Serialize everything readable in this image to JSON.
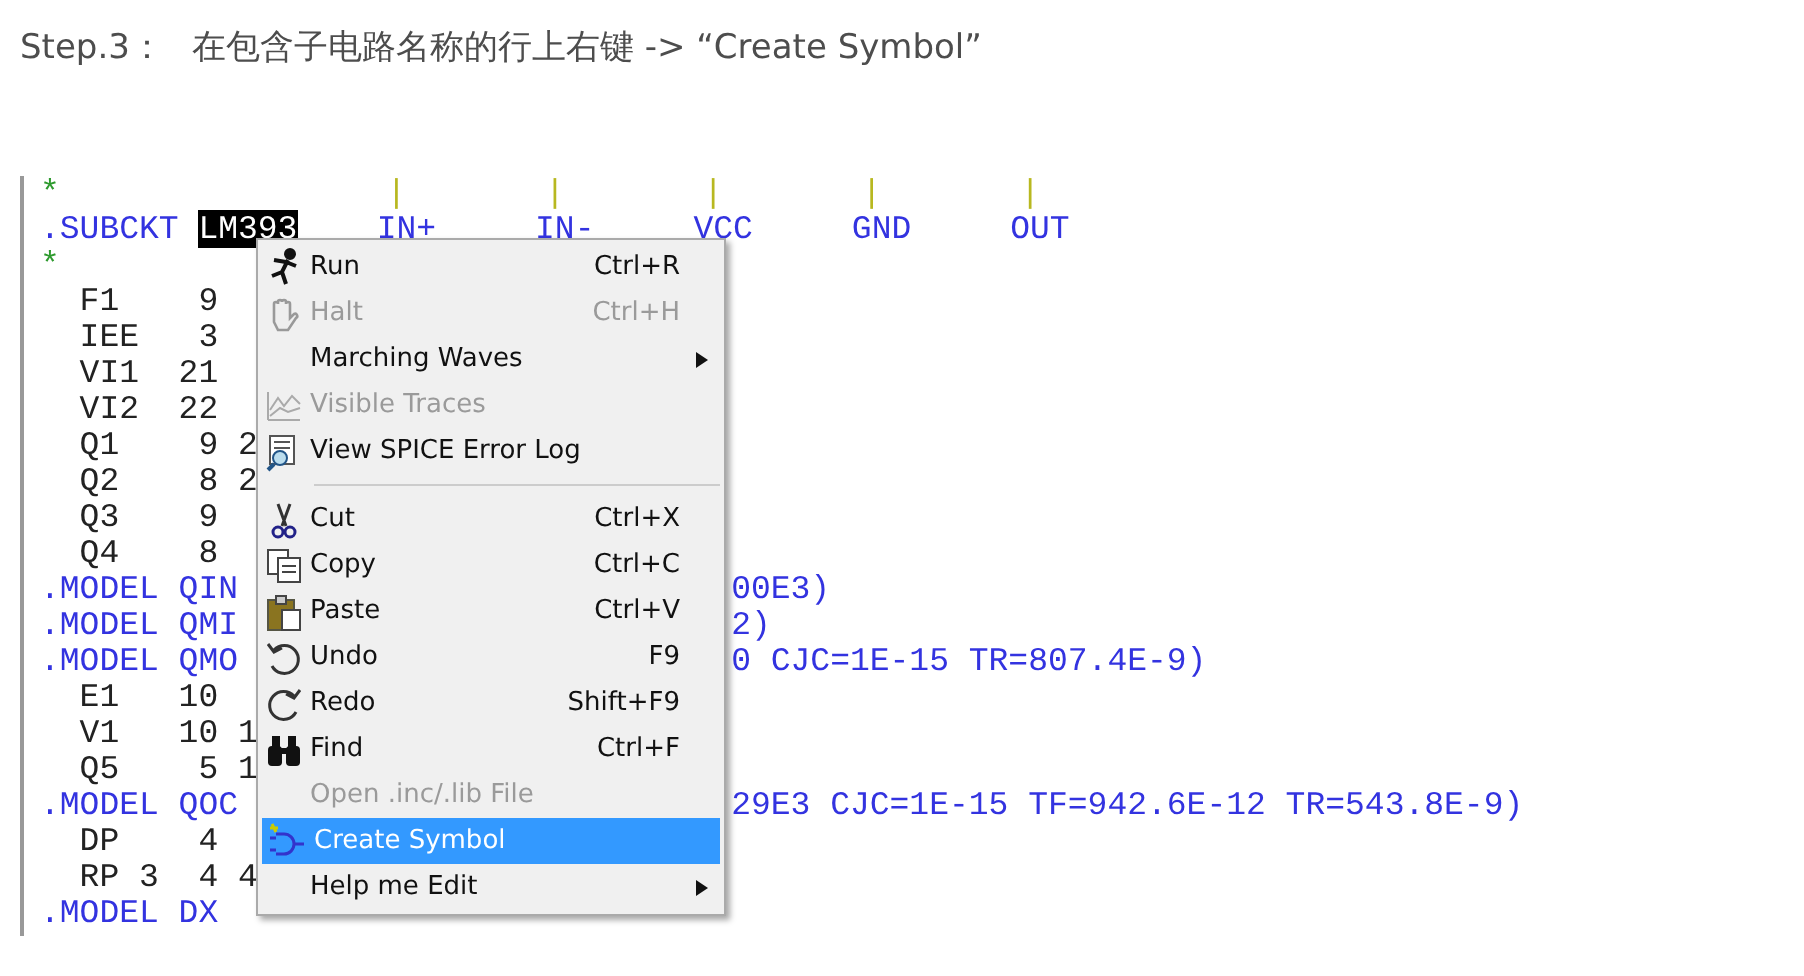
{
  "heading": {
    "step": "Step.3：",
    "text": "在包含子电路名称的行上右键 -> “Create Symbol”"
  },
  "editor": {
    "marker_line": {
      "star": "*",
      "marks": [
        "|",
        "|",
        "|",
        "|",
        "|"
      ]
    },
    "subckt_line": {
      "keyword": ".SUBCKT",
      "name": "LM393",
      "name_selected": true,
      "pins": [
        "IN+",
        "IN-",
        "VCC",
        "GND",
        "OUT"
      ]
    },
    "lines": [
      {
        "kind": "comment",
        "text": "*"
      },
      {
        "kind": "element",
        "text": "  F1    9"
      },
      {
        "kind": "element",
        "text": "  IEE   3"
      },
      {
        "kind": "element",
        "text": "  VI1  21"
      },
      {
        "kind": "element",
        "text": "  VI2  22"
      },
      {
        "kind": "element",
        "text": "  Q1    9 2"
      },
      {
        "kind": "element",
        "text": "  Q2    8 2"
      },
      {
        "kind": "element",
        "text": "  Q3    9"
      },
      {
        "kind": "element",
        "text": "  Q4    8"
      },
      {
        "kind": "directive",
        "text": ".MODEL QIN",
        "tail": "00E3)"
      },
      {
        "kind": "directive",
        "text": ".MODEL QMI",
        "tail": "2)"
      },
      {
        "kind": "directive",
        "text": ".MODEL QMO",
        "tail": "0 CJC=1E-15 TR=807.4E-9)"
      },
      {
        "kind": "element",
        "text": "  E1   10"
      },
      {
        "kind": "element",
        "text": "  V1   10 1"
      },
      {
        "kind": "element",
        "text": "  Q5    5 1"
      },
      {
        "kind": "directive",
        "text": ".MODEL QOC",
        "tail": "29E3 CJC=1E-15 TF=942.6E-12 TR=543.8E-9)"
      },
      {
        "kind": "element",
        "text": "  DP    4"
      },
      {
        "kind": "element",
        "text": "  RP 3  4 4"
      },
      {
        "kind": "directive",
        "text": ".MODEL DX"
      }
    ]
  },
  "context_menu": {
    "items": [
      {
        "kind": "item",
        "label": "Run",
        "shortcut": "Ctrl+R",
        "disabled": false,
        "selected": false,
        "submenu": false
      },
      {
        "kind": "item",
        "label": "Halt",
        "shortcut": "Ctrl+H",
        "disabled": true,
        "selected": false,
        "submenu": false
      },
      {
        "kind": "item",
        "label": "Marching Waves",
        "disabled": false,
        "selected": false,
        "submenu": true
      },
      {
        "kind": "item",
        "label": "Visible Traces",
        "disabled": true,
        "selected": false,
        "submenu": false
      },
      {
        "kind": "item",
        "label": "View SPICE Error Log",
        "disabled": false,
        "selected": false,
        "submenu": false
      },
      {
        "kind": "separator"
      },
      {
        "kind": "item",
        "label": "Cut",
        "shortcut": "Ctrl+X",
        "disabled": false,
        "selected": false,
        "submenu": false
      },
      {
        "kind": "item",
        "label": "Copy",
        "shortcut": "Ctrl+C",
        "disabled": false,
        "selected": false,
        "submenu": false
      },
      {
        "kind": "item",
        "label": "Paste",
        "shortcut": "Ctrl+V",
        "disabled": false,
        "selected": false,
        "submenu": false
      },
      {
        "kind": "item",
        "label": "Undo",
        "shortcut": "F9",
        "disabled": false,
        "selected": false,
        "submenu": false
      },
      {
        "kind": "item",
        "label": "Redo",
        "shortcut": "Shift+F9",
        "disabled": false,
        "selected": false,
        "submenu": false
      },
      {
        "kind": "item",
        "label": "Find",
        "shortcut": "Ctrl+F",
        "disabled": false,
        "selected": false,
        "submenu": false
      },
      {
        "kind": "item",
        "label": "Open .inc/.lib File",
        "disabled": true,
        "selected": false,
        "submenu": false
      },
      {
        "kind": "item",
        "label": "Create Symbol",
        "disabled": false,
        "selected": true,
        "submenu": false
      },
      {
        "kind": "item",
        "label": "Help me Edit",
        "disabled": false,
        "selected": false,
        "submenu": true
      }
    ]
  }
}
